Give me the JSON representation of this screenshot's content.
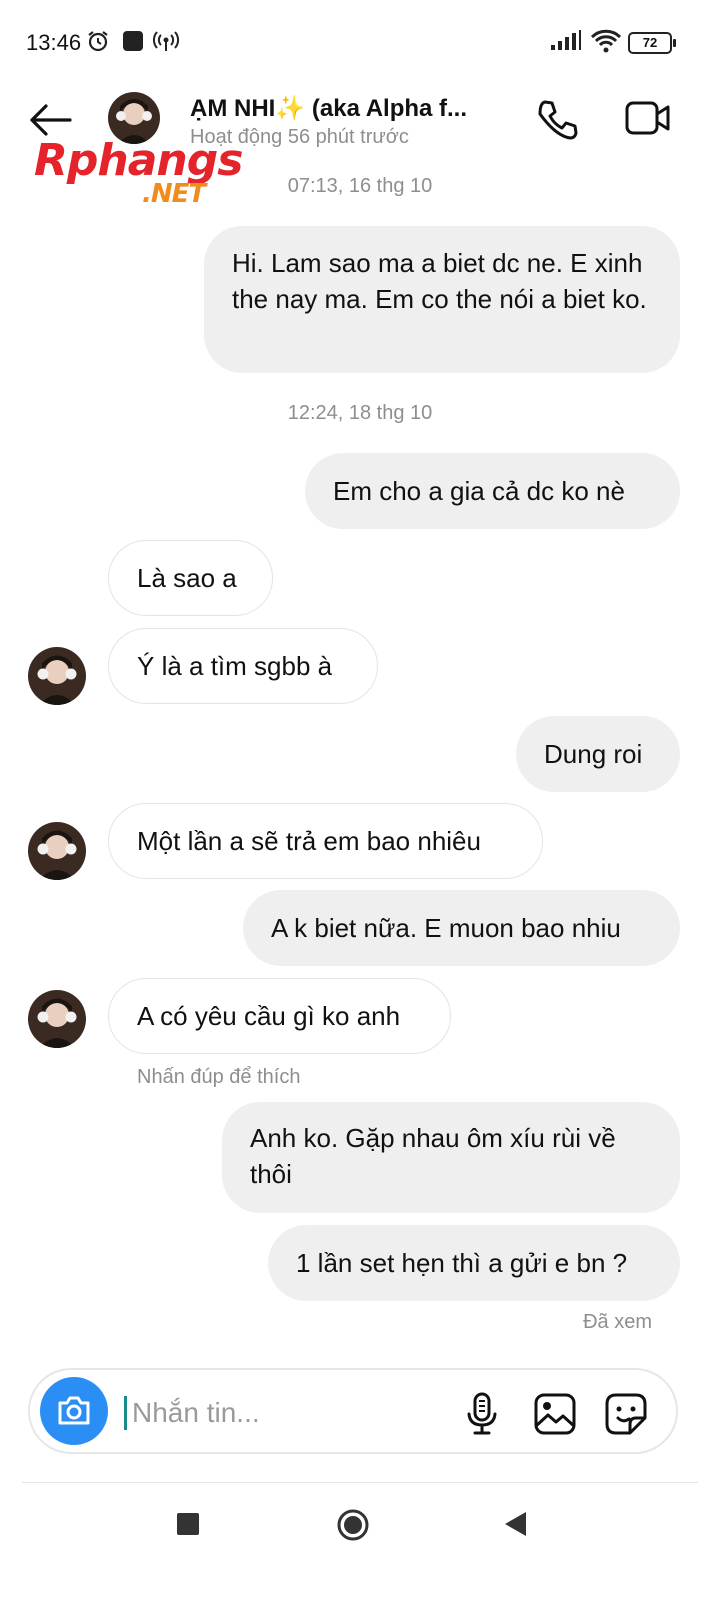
{
  "status_bar": {
    "time": "13:46",
    "battery": "72",
    "icons": [
      "alarm-icon",
      "app-notification-icon",
      "hotspot-icon",
      "signal-icon",
      "wifi-icon",
      "battery-icon"
    ]
  },
  "watermark": {
    "main": "Rphangs",
    "suffix": ".NET"
  },
  "header": {
    "name": "ẠM NHI✨ (aka Alpha f...",
    "status": "Hoạt động 56 phút trước",
    "icons": [
      "back-arrow-icon",
      "phone-icon",
      "video-icon"
    ]
  },
  "conversation": {
    "timestamps": [
      "07:13, 16 thg 10",
      "12:24, 18 thg 10"
    ],
    "messages": [
      {
        "side": "out",
        "text": "Hi. Lam sao ma a biet dc ne. E xinh the nay ma. Em co the nói a biet ko."
      },
      {
        "side": "out",
        "text": "Em cho a gia cả dc ko nè"
      },
      {
        "side": "in",
        "text": "Là sao a"
      },
      {
        "side": "in",
        "text": "Ý là a tìm sgbb à"
      },
      {
        "side": "out",
        "text": "Dung roi"
      },
      {
        "side": "in",
        "text": "Một lần a sẽ trả em bao nhiêu"
      },
      {
        "side": "out",
        "text": "A k biet nữa. E muon bao nhiu"
      },
      {
        "side": "in",
        "text": "A có yêu cầu gì ko anh"
      },
      {
        "side": "out",
        "text": "Anh ko. Gặp nhau ôm xíu rùi về thôi"
      },
      {
        "side": "out",
        "text": "1 lần set hẹn thì a gửi e bn ?"
      }
    ],
    "double_tap_hint": "Nhấn đúp để thích",
    "seen": "Đã xem"
  },
  "composer": {
    "placeholder": "Nhắn tin...",
    "value": "",
    "icons": [
      "camera-icon",
      "microphone-icon",
      "gallery-icon",
      "sticker-icon"
    ]
  },
  "nav_bar": {
    "icons": [
      "recents-square-icon",
      "home-circle-icon",
      "back-triangle-icon"
    ]
  },
  "colors": {
    "accent": "#2b8ef5",
    "bubble_out": "#efefef",
    "secondary_text": "#8e8e8e"
  }
}
